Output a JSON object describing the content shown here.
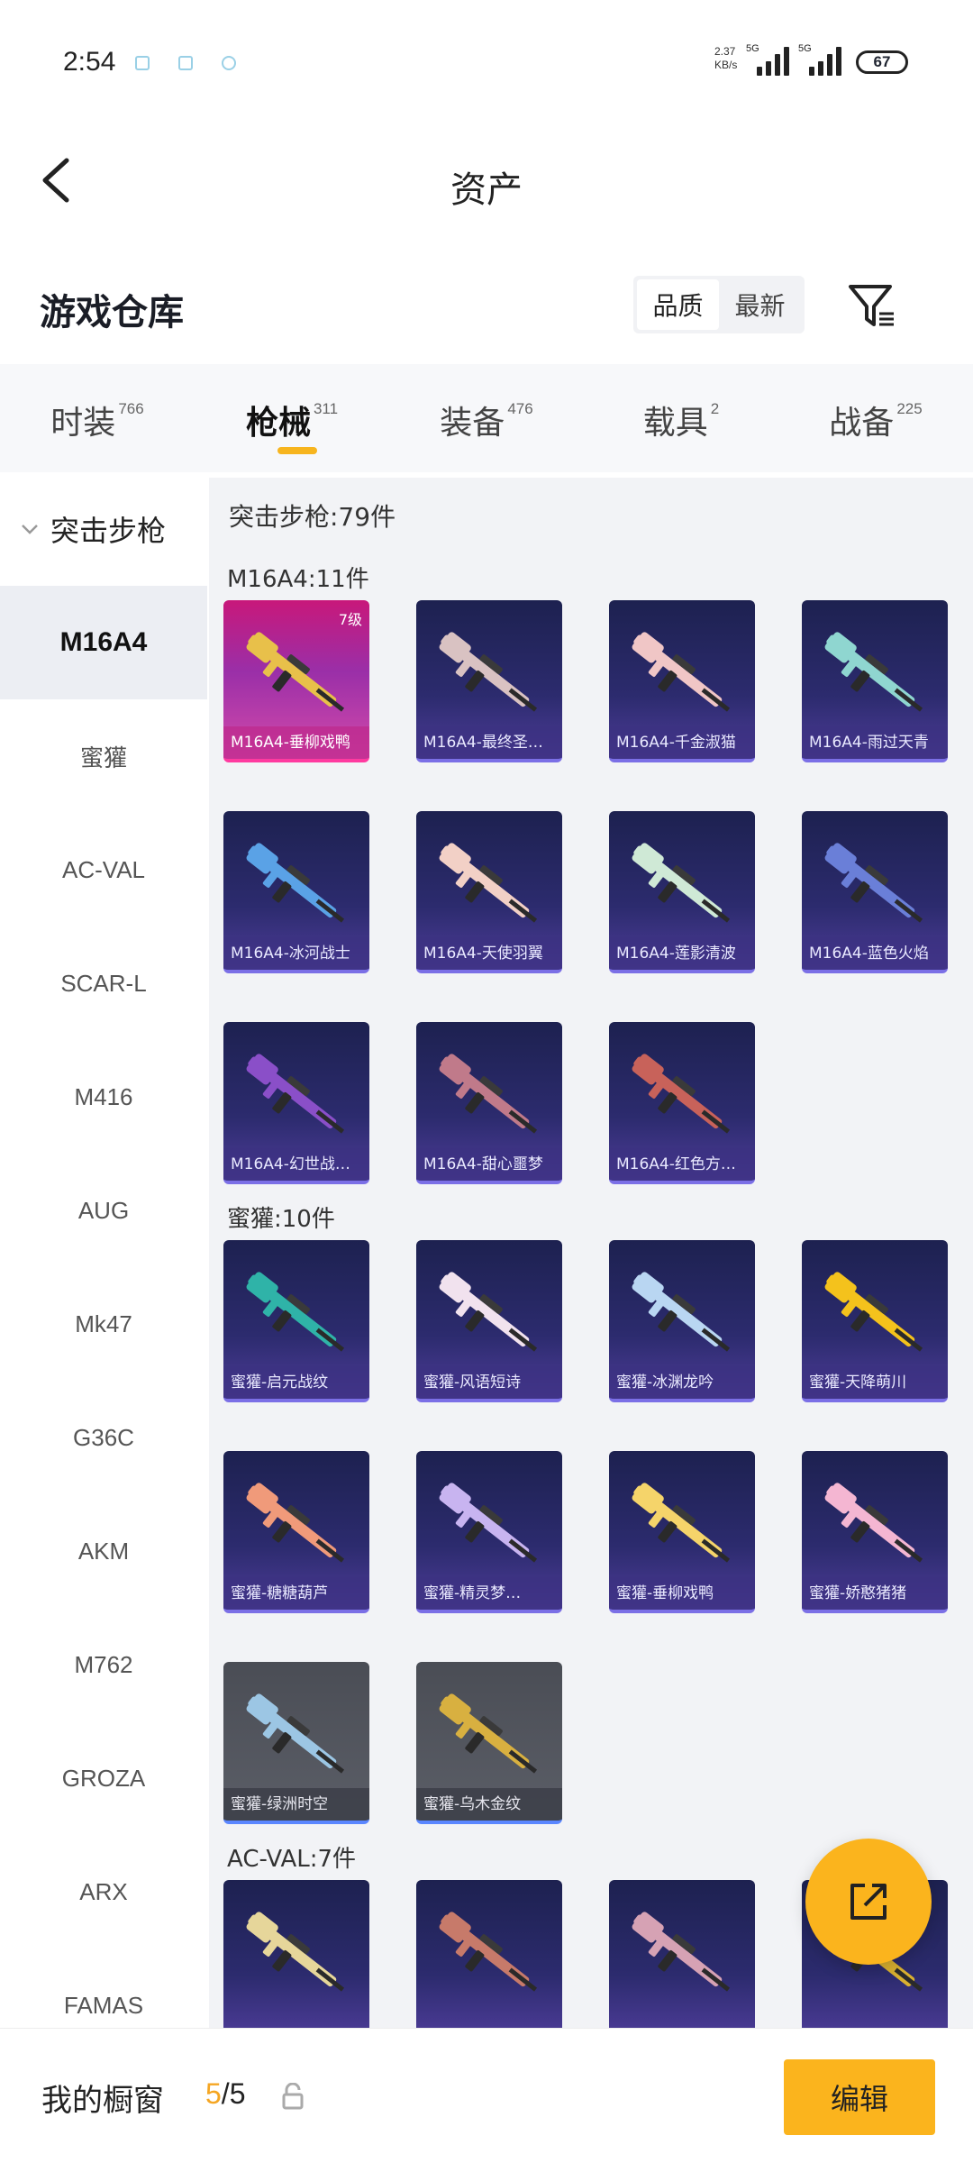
{
  "status_bar": {
    "time": "2:54",
    "speed_value": "2.37",
    "speed_unit": "KB/s",
    "net1": "5G",
    "net2": "5G",
    "battery": "67"
  },
  "header": {
    "title": "资产",
    "back_icon": "chevron-left-icon"
  },
  "section": {
    "title": "游戏仓库",
    "sort_options": [
      "品质",
      "最新"
    ],
    "filter_icon": "filter-icon"
  },
  "tabs": [
    {
      "label": "时装",
      "count": "766"
    },
    {
      "label": "枪械",
      "count": "311"
    },
    {
      "label": "装备",
      "count": "476"
    },
    {
      "label": "载具",
      "count": "2"
    },
    {
      "label": "战备",
      "count": "225"
    }
  ],
  "sidebar": {
    "group": "突击步枪",
    "items": [
      "M16A4",
      "蜜獾",
      "AC-VAL",
      "SCAR-L",
      "M416",
      "AUG",
      "Mk47",
      "G36C",
      "AKM",
      "M762",
      "GROZA",
      "ARX",
      "FAMAS"
    ]
  },
  "content": {
    "group_title": "突击步枪:79件",
    "sections": [
      {
        "title": "M16A4:11件",
        "cards": [
          {
            "name": "M16A4-垂柳戏鸭",
            "level": "7级",
            "style": "gold",
            "gun_color": "#e8c04a"
          },
          {
            "name": "M16A4-最终圣…",
            "style": "purple",
            "gun_color": "#d9c2c2"
          },
          {
            "name": "M16A4-千金淑猫",
            "style": "purple",
            "gun_color": "#f0c6c6"
          },
          {
            "name": "M16A4-雨过天青",
            "style": "purple",
            "gun_color": "#8fd6d0"
          },
          {
            "name": "M16A4-冰河战士",
            "style": "purple",
            "gun_color": "#5aa2e6"
          },
          {
            "name": "M16A4-天使羽翼",
            "style": "purple",
            "gun_color": "#f2d0c6"
          },
          {
            "name": "M16A4-莲影清波",
            "style": "purple",
            "gun_color": "#cfe9d6"
          },
          {
            "name": "M16A4-蓝色火焰",
            "style": "purple",
            "gun_color": "#6a7fd8"
          },
          {
            "name": "M16A4-幻世战…",
            "style": "purple",
            "gun_color": "#8a4fc8"
          },
          {
            "name": "M16A4-甜心噩梦",
            "style": "purple",
            "gun_color": "#c07a8a"
          },
          {
            "name": "M16A4-红色方…",
            "style": "purple",
            "gun_color": "#c8625a"
          }
        ]
      },
      {
        "title": "蜜獾:10件",
        "cards": [
          {
            "name": "蜜獾-启元战纹",
            "style": "purple",
            "gun_color": "#2fb3a8"
          },
          {
            "name": "蜜獾-风语短诗",
            "style": "purple",
            "gun_color": "#f1e2ee"
          },
          {
            "name": "蜜獾-冰渊龙吟",
            "style": "purple",
            "gun_color": "#b9d6f2"
          },
          {
            "name": "蜜獾-天降萌川",
            "style": "purple",
            "gun_color": "#f4c21c"
          },
          {
            "name": "蜜獾-糖糖葫芦",
            "style": "purple",
            "gun_color": "#f09a7a"
          },
          {
            "name": "蜜獾-精灵梦…",
            "style": "purple",
            "gun_color": "#c8b4f0"
          },
          {
            "name": "蜜獾-垂柳戏鸭",
            "style": "purple",
            "gun_color": "#f5d46a"
          },
          {
            "name": "蜜獾-娇憨猪猪",
            "style": "purple",
            "gun_color": "#f4b6d2"
          },
          {
            "name": "蜜獾-绿洲时空",
            "style": "gray",
            "gun_color": "#9cc6e4"
          },
          {
            "name": "蜜獾-乌木金纹",
            "style": "gray",
            "gun_color": "#d8b040"
          }
        ]
      },
      {
        "title": "AC-VAL:7件",
        "cards": [
          {
            "name": "",
            "style": "purple",
            "gun_color": "#e6d69a"
          },
          {
            "name": "",
            "style": "purple",
            "gun_color": "#c77a6a"
          },
          {
            "name": "",
            "style": "purple",
            "gun_color": "#d6a2b4"
          },
          {
            "name": "",
            "style": "purple",
            "gun_color": "#d9b030"
          }
        ]
      }
    ]
  },
  "fab_icon": "share-out-icon",
  "bottom_bar": {
    "label": "我的橱窗",
    "current": "5",
    "total": "/5",
    "lock_icon": "lock-icon",
    "edit_label": "编辑"
  }
}
